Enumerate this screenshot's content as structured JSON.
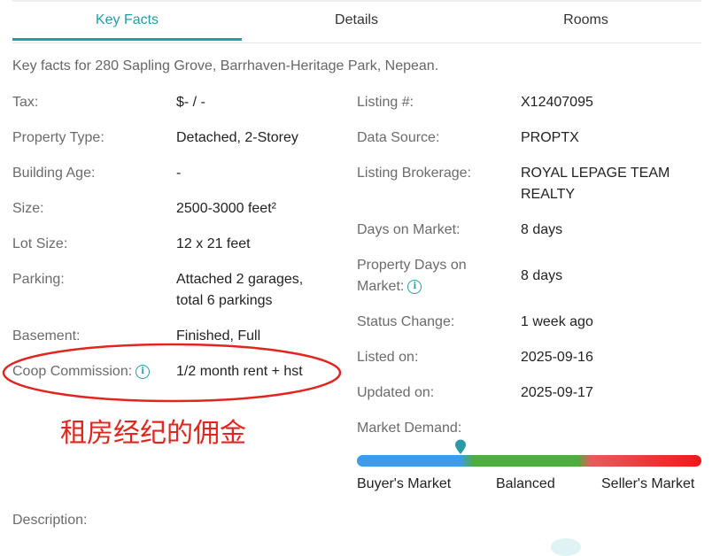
{
  "tabs": [
    "Key Facts",
    "Details",
    "Rooms"
  ],
  "active_tab": "Key Facts",
  "intro": "Key facts for 280 Sapling Grove, Barrhaven-Heritage Park, Nepean.",
  "left": {
    "tax": {
      "label": "Tax:",
      "value": "$- / -"
    },
    "property_type": {
      "label": "Property Type:",
      "value": "Detached, 2-Storey"
    },
    "building_age": {
      "label": "Building Age:",
      "value": "-"
    },
    "size": {
      "label": "Size:",
      "value": "2500-3000 feet²"
    },
    "lot_size": {
      "label": "Lot Size:",
      "value": "12 x 21 feet"
    },
    "parking": {
      "label": "Parking:",
      "value_line1": "Attached 2 garages,",
      "value_line2": "total 6 parkings"
    },
    "basement": {
      "label": "Basement:",
      "value": "Finished, Full"
    },
    "coop": {
      "label": "Coop Commission:",
      "value": "1/2 month rent + hst"
    }
  },
  "right": {
    "listing": {
      "label": "Listing #:",
      "value": "X12407095"
    },
    "data_source": {
      "label": "Data Source:",
      "value": "PROPTX"
    },
    "brokerage": {
      "label": "Listing Brokerage:",
      "value_line1": "ROYAL LEPAGE TEAM",
      "value_line2": "REALTY"
    },
    "days_on_market": {
      "label": "Days on Market:",
      "value": "8 days"
    },
    "property_days": {
      "label_line1": "Property Days on",
      "label_line2": "Market:",
      "value": "8 days"
    },
    "status_change": {
      "label": "Status Change:",
      "value": "1 week ago"
    },
    "listed_on": {
      "label": "Listed on:",
      "value": "2025-09-16"
    },
    "updated_on": {
      "label": "Updated on:",
      "value": "2025-09-17"
    },
    "market_demand": {
      "label": "Market Demand:",
      "position_fraction": 0.3
    },
    "scale": {
      "buyer": "Buyer's Market",
      "balanced": "Balanced",
      "seller": "Seller's Market"
    }
  },
  "description_label": "Description:",
  "annotation": "租房经纪的佣金",
  "colors": {
    "accent": "#2a9aa6",
    "annotation": "#e0261f",
    "buyer": "#3d9be9",
    "balanced": "#4cae3b",
    "seller": "#f01818"
  }
}
